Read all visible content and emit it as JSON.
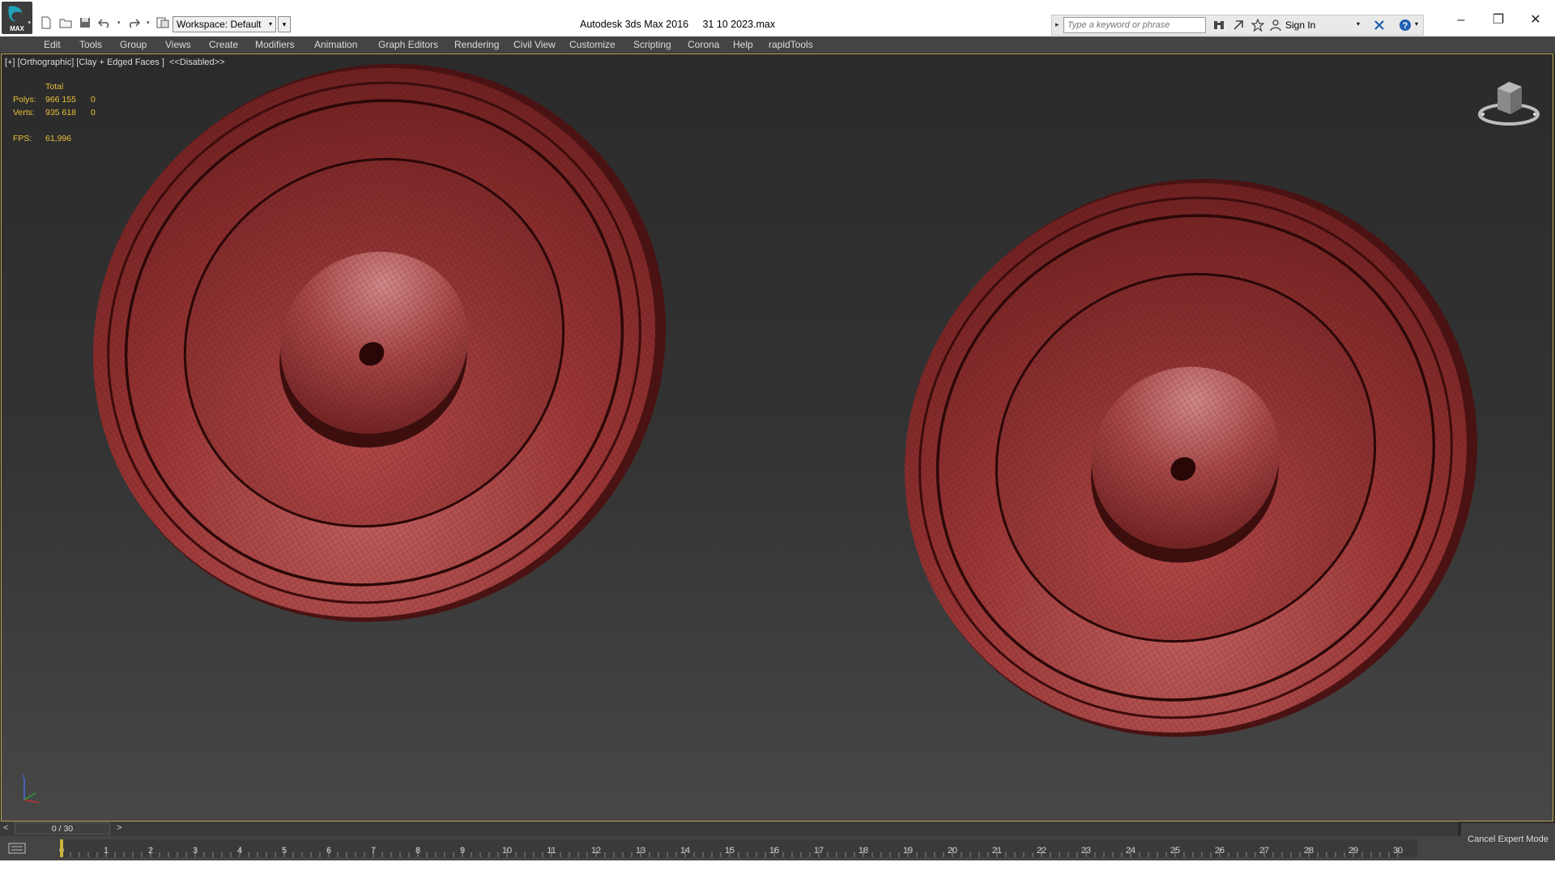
{
  "app": {
    "logo_text": "MAX",
    "title": "Autodesk 3ds Max 2016     31 10 2023.max"
  },
  "workspace": {
    "label": "Workspace: Default"
  },
  "search": {
    "placeholder": "Type a keyword or phrase"
  },
  "account": {
    "sign_in": "Sign In"
  },
  "menu": {
    "items": [
      {
        "label": "Edit"
      },
      {
        "label": "Tools"
      },
      {
        "label": "Group"
      },
      {
        "label": "Views"
      },
      {
        "label": "Create"
      },
      {
        "label": "Modifiers"
      },
      {
        "label": "Animation"
      },
      {
        "label": "Graph Editors"
      },
      {
        "label": "Rendering"
      },
      {
        "label": "Civil View"
      },
      {
        "label": "Customize"
      },
      {
        "label": "Scripting"
      },
      {
        "label": "Corona"
      },
      {
        "label": "Help"
      },
      {
        "label": "rapidTools"
      }
    ]
  },
  "viewport": {
    "label": "[+] [Orthographic] [Clay + Edged Faces ]  <<Disabled>>",
    "stats": {
      "header": "Total",
      "polys_label": "Polys:",
      "polys_total": "966 155",
      "polys_sel": "0",
      "verts_label": "Verts:",
      "verts_total": "935 618",
      "verts_sel": "0",
      "fps_label": "FPS:",
      "fps_value": "61,996"
    },
    "mesh_color": "#8e2e2e",
    "border_color": "#b8a24a"
  },
  "timeline": {
    "prev": "<",
    "next": ">",
    "frame_display": "0 / 30",
    "current_frame": 0,
    "ticks": [
      "0",
      "1",
      "2",
      "3",
      "4",
      "5",
      "6",
      "7",
      "8",
      "9",
      "10",
      "11",
      "12",
      "13",
      "14",
      "15",
      "16",
      "17",
      "18",
      "19",
      "20",
      "21",
      "22",
      "23",
      "24",
      "25",
      "26",
      "27",
      "28",
      "29",
      "30"
    ]
  },
  "status": {
    "cancel_expert": "Cancel Expert Mode"
  }
}
